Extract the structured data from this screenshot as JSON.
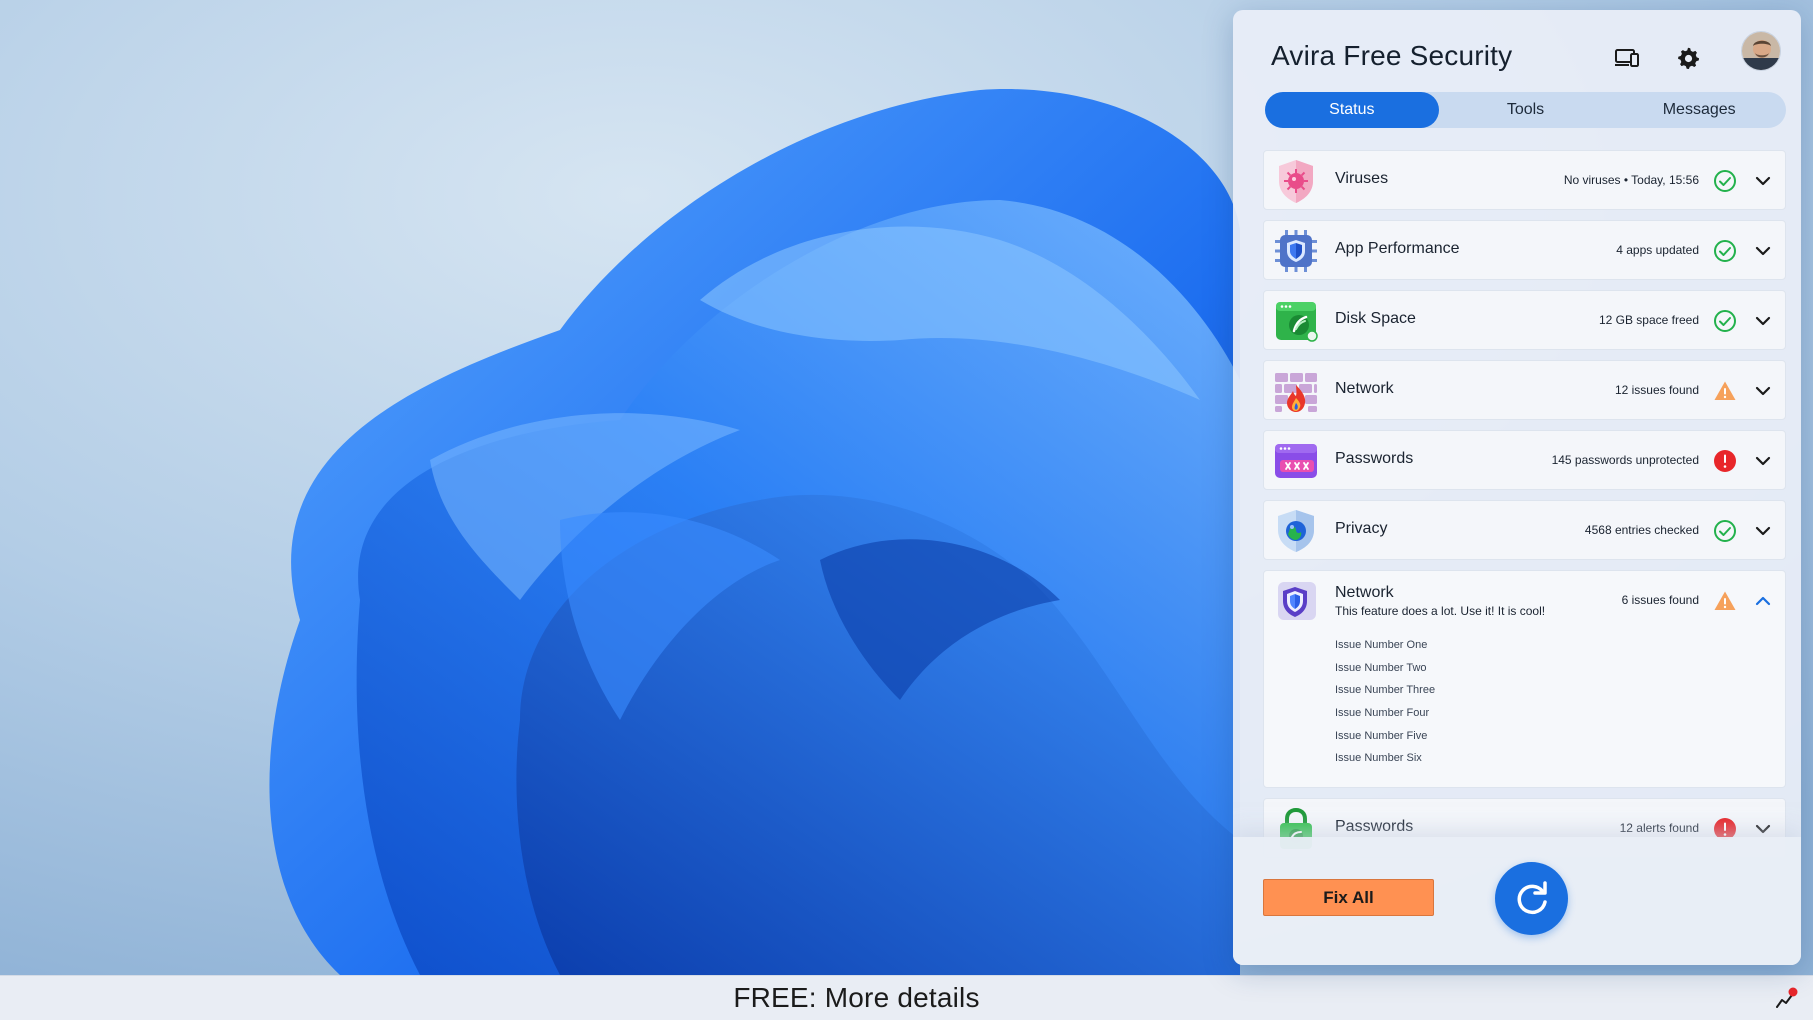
{
  "app": {
    "title": "Avira Free Security"
  },
  "header": {
    "icons": [
      "devices-icon",
      "gear-icon",
      "avatar"
    ]
  },
  "tabs": [
    {
      "label": "Status",
      "active": true
    },
    {
      "label": "Tools",
      "active": false
    },
    {
      "label": "Messages",
      "active": false
    }
  ],
  "rows": [
    {
      "name": "Viruses",
      "status": "No viruses • Today, 15:56",
      "state": "ok",
      "icon": "virus-icon"
    },
    {
      "name": "App Performance",
      "status": "4 apps updated",
      "state": "ok",
      "icon": "chip-shield-icon"
    },
    {
      "name": "Disk Space",
      "status": "12 GB space freed",
      "state": "ok",
      "icon": "disk-icon"
    },
    {
      "name": "Network",
      "status": "12 issues found",
      "state": "warning",
      "icon": "firewall-icon"
    },
    {
      "name": "Passwords",
      "status": "145 passwords unprotected",
      "state": "error",
      "icon": "password-icon"
    },
    {
      "name": "Privacy",
      "status": "4568 entries checked",
      "state": "ok",
      "icon": "privacy-shield-icon"
    }
  ],
  "expanded_row": {
    "name": "Network",
    "description": "This feature does a lot. Use it! It is cool!",
    "status": "6 issues found",
    "state": "warning",
    "icon": "network-shield-icon",
    "issues": [
      "Issue Number One",
      "Issue Number Two",
      "Issue Number Three",
      "Issue Number Four",
      "Issue Number Five",
      "Issue Number Six"
    ]
  },
  "last_row": {
    "name": "Passwords",
    "status": "12 alerts found",
    "state": "error",
    "icon": "lock-icon"
  },
  "actions": {
    "fix_all_label": "Fix All",
    "refresh_icon": "refresh-icon"
  },
  "bottom_bar": {
    "label": "FREE: More details"
  },
  "colors": {
    "accent": "#1a6fe0",
    "ok": "#22b14c",
    "warning": "#f08a3c",
    "error": "#e8262a",
    "fix_button": "#ff9152"
  }
}
